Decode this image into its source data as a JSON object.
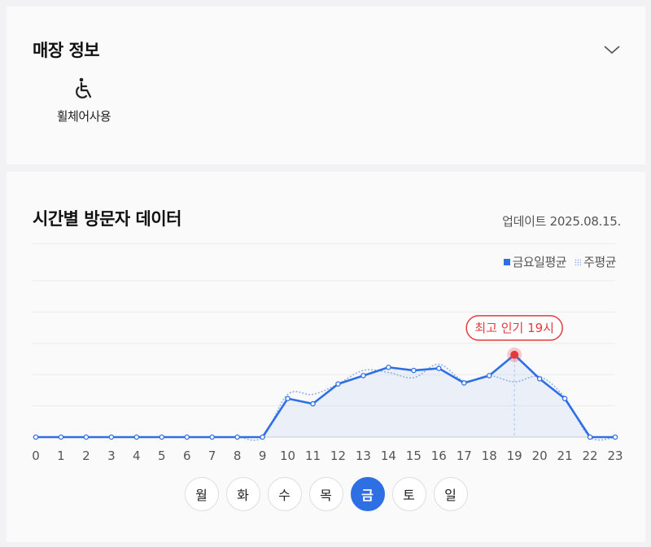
{
  "store_info": {
    "title": "매장 정보",
    "facilities": [
      {
        "label": "휠체어사용",
        "icon": "wheelchair-icon"
      }
    ]
  },
  "visitor_data": {
    "title": "시간별 방문자 데이터",
    "update_label": "업데이트",
    "update_date": "2025.08.15.",
    "days": [
      "월",
      "화",
      "수",
      "목",
      "금",
      "토",
      "일"
    ],
    "selected_day": "금"
  },
  "colors": {
    "accent": "#2f6fe4",
    "peak": "#e23b3b",
    "weekly": "#8fb2ee"
  },
  "chart_data": {
    "type": "line",
    "x": [
      0,
      1,
      2,
      3,
      4,
      5,
      6,
      7,
      8,
      9,
      10,
      11,
      12,
      13,
      14,
      15,
      16,
      17,
      18,
      19,
      20,
      21,
      22,
      23
    ],
    "series": [
      {
        "name": "금요일평균",
        "style": "solid",
        "values": [
          0,
          0,
          0,
          0,
          0,
          0,
          0,
          0,
          0,
          0,
          37,
          32,
          51,
          59,
          67,
          64,
          66,
          52,
          59,
          79,
          56,
          37,
          0,
          0
        ]
      },
      {
        "name": "주평균",
        "style": "dotted",
        "values": [
          0,
          0,
          0,
          0,
          0,
          0,
          0,
          0,
          0,
          0,
          41,
          41,
          51,
          64,
          62,
          57,
          70,
          54,
          59,
          53,
          58,
          38,
          0,
          0
        ]
      }
    ],
    "peak": {
      "hour": 19,
      "label": "최고 인기 19시"
    },
    "ylim": [
      0,
      150
    ],
    "grid": true,
    "legend": "top-right"
  }
}
